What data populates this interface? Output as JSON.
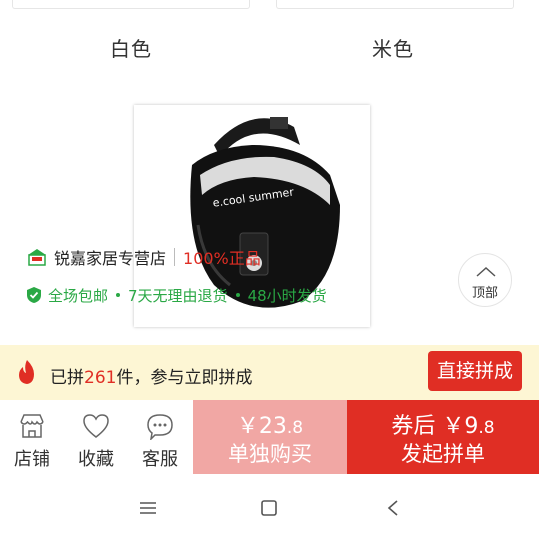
{
  "swatches": [
    {
      "label": "白色"
    },
    {
      "label": "米色"
    }
  ],
  "product": {
    "brand_text": "e.cool summer",
    "image_icon": "sun-visor-image"
  },
  "shop": {
    "name": "锐嘉家居专营店",
    "genuine": "100%正品",
    "icon": "shop-icon"
  },
  "promos": [
    "全场包邮",
    "7天无理由退货",
    "48小时发货"
  ],
  "top_button": {
    "label": "顶部",
    "icon": "chevron-up-icon"
  },
  "group_bar": {
    "prefix": "已拼",
    "count": "261",
    "suffix": "件，参与立即拼成",
    "button": "直接拼成",
    "icon": "flame-icon"
  },
  "actions": {
    "shop": "店铺",
    "favorite": "收藏",
    "service": "客服"
  },
  "buy_single": {
    "currency": "￥",
    "price_int": "23",
    "price_dec": ".8",
    "label": "单独购买"
  },
  "buy_group": {
    "prefix": "券后",
    "currency": "￥",
    "price_int": "9",
    "price_dec": ".8",
    "label": "发起拼单"
  },
  "colors": {
    "brand_red": "#e02e24",
    "green": "#2aa845",
    "pale_red": "#f1a7a4",
    "bar_yellow": "#fdf6d4"
  }
}
